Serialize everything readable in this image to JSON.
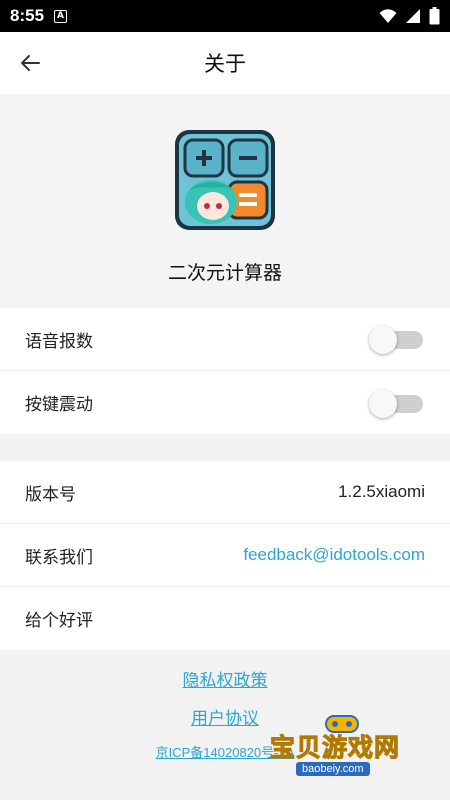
{
  "status_bar": {
    "time": "8:55",
    "notification_glyph": "A"
  },
  "header": {
    "title": "关于",
    "back_icon": "arrow-left-icon"
  },
  "app": {
    "name": "二次元计算器",
    "icon": "anime-calculator-app-icon"
  },
  "settings": [
    {
      "label": "语音报数",
      "toggle_on": false
    },
    {
      "label": "按键震动",
      "toggle_on": false
    }
  ],
  "info": {
    "version_label": "版本号",
    "version_value": "1.2.5xiaomi",
    "contact_label": "联系我们",
    "contact_value": "feedback@idotools.com",
    "rate_label": "给个好评"
  },
  "footer": {
    "privacy": "隐私权政策",
    "agreement": "用户协议",
    "icp": "京ICP备14020820号-1A"
  },
  "watermark": {
    "text": "宝贝游戏网",
    "url": "baobeiy.com"
  },
  "colors": {
    "link": "#2ba6d6",
    "background": "#f2f2f2",
    "status_bar": "#000000"
  }
}
